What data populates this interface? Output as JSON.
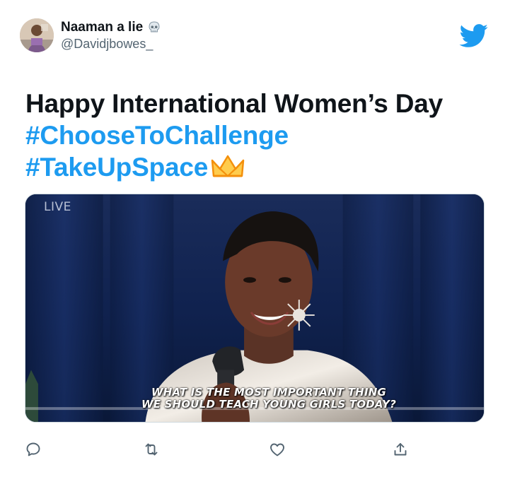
{
  "user": {
    "display_name": "Naaman a lie",
    "handle": "@Davidjbowes_",
    "name_emoji_icon": "skull-icon"
  },
  "brand": {
    "logo_icon": "twitter-bird-icon",
    "color": "#1d9bf0"
  },
  "tweet": {
    "text_plain": "Happy International Women’s Day ",
    "hashtag_1": "#ChooseToChallenge",
    "hashtag_2": "#TakeUpSpace",
    "trailing_emoji_icon": "crown-icon"
  },
  "media": {
    "live_label": "LIVE",
    "caption_line_1": "WHAT IS THE MOST IMPORTANT THING",
    "caption_line_2": "WE SHOULD TEACH YOUNG GIRLS TODAY?"
  },
  "actions": [
    {
      "name": "reply",
      "icon": "reply-icon"
    },
    {
      "name": "retweet",
      "icon": "retweet-icon"
    },
    {
      "name": "like",
      "icon": "heart-icon"
    },
    {
      "name": "share",
      "icon": "share-icon"
    }
  ],
  "colors": {
    "text_primary": "#0f1419",
    "text_secondary": "#536471",
    "hashtag": "#1d9bf0",
    "crown": "#f4900c"
  }
}
